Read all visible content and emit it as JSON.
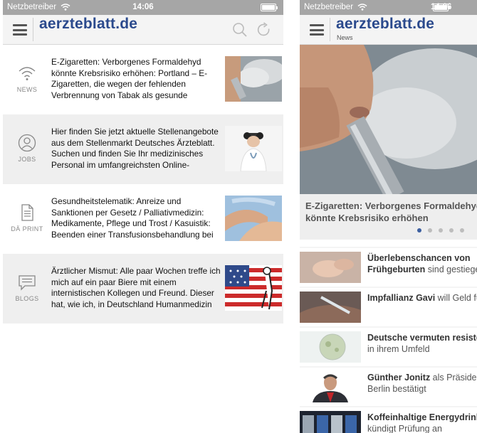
{
  "left": {
    "status": {
      "carrier": "Netzbetreiber",
      "time": "14:06"
    },
    "appbar": {
      "brand": "aerzteblatt.de"
    },
    "items": [
      {
        "category": "NEWS",
        "text": "E-Zigaretten: Verborgenes Formaldehyd könnte Krebsrisiko erhöhen: Portland – E-Zigaretten, die wegen der fehlenden Verbrennung von Tabak als gesunde Alternative zu konventionellen Zigaretten…"
      },
      {
        "category": "JOBS",
        "text": "Hier finden Sie jetzt aktuelle Stellenangebote aus dem Stellenmarkt Deutsches Ärzteblatt. Suchen und finden Sie Ihr medizinisches Personal im umfangreichsten Online-Stellenmarkt f…"
      },
      {
        "category": "DÄ PRINT",
        "text": "Gesundheitstelematik: Anreize und Sanktionen per Gesetz / Palliativmedizin: Medikamente, Pflege und Trost / Kasuistik: Beenden einer Transfusionsbehandlung bei Patientin mit infauster Prognose"
      },
      {
        "category": "BLOGS",
        "text": "Ärztlicher Mismut: Alle paar Wochen treffe ich mich auf ein paar Biere mit einem internistischen Kollegen und Freund. Dieser hat, wie ich, in Deutschland Humanmedizin studiert und dort eine Zei…"
      }
    ]
  },
  "right": {
    "status": {
      "carrier": "Netzbetreiber",
      "time": "14:06"
    },
    "appbar": {
      "brand": "aerzteblatt.de",
      "subtitle": "News"
    },
    "hero": {
      "title": "E-Zigaretten: Verborgenes Formaldehyd könnte Krebsrisiko erhöhen"
    },
    "carousel": {
      "count": 5,
      "active": 0
    },
    "feed": [
      {
        "bold": "Überlebenschancen von",
        "rest": "Frühgeburten sind gestiegen",
        "bold_second_line": true
      },
      {
        "bold": "Impfallianz Gavi",
        "rest": " will Geld für Millionen Kinder einsammeln"
      },
      {
        "bold": "Deutsche vermuten resistente Keime",
        "rest": "in ihrem Umfeld"
      },
      {
        "bold": "Günther Jonitz",
        "rest": " als Präsident in Berlin bestätigt"
      },
      {
        "bold": "Koffeinhaltige Energydrinks: EU",
        "rest": "kündigt Prüfung an"
      }
    ]
  },
  "colors": {
    "brand": "#2b4a8d",
    "statusbar": "#a6a6a6",
    "dot_active": "#3c5fa0"
  }
}
